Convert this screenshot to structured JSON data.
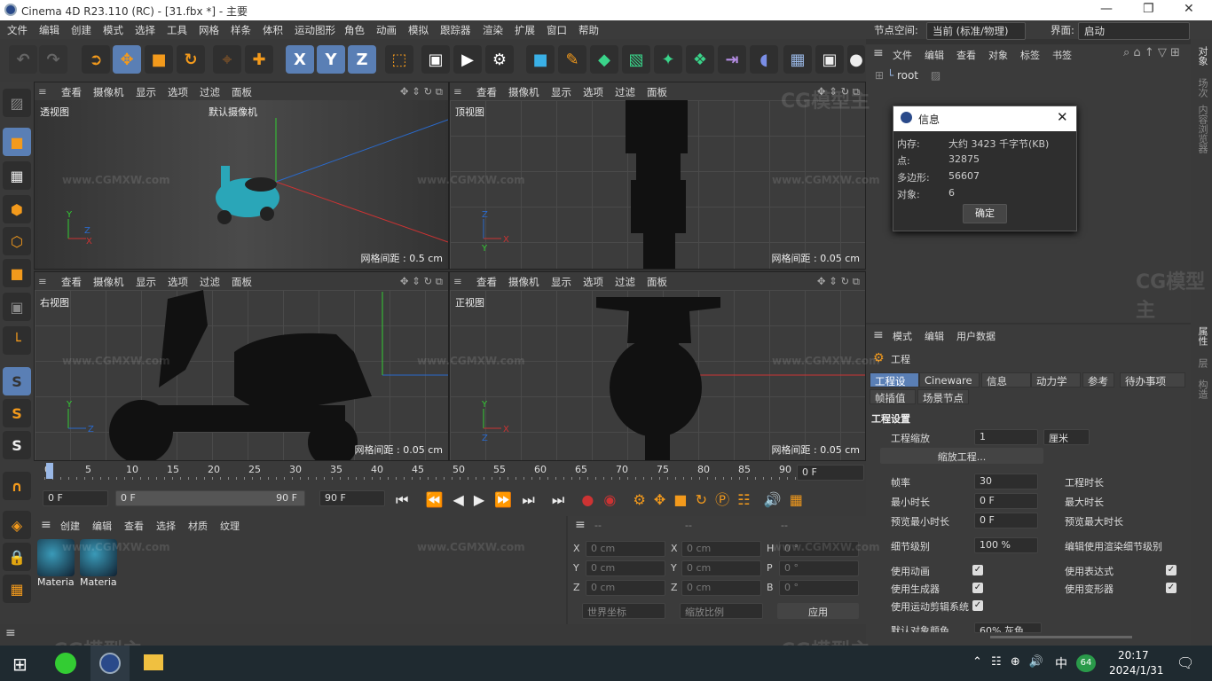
{
  "title": "Cinema 4D R23.110 (RC) - [31.fbx *] - 主要",
  "menu": [
    "文件",
    "编辑",
    "创建",
    "模式",
    "选择",
    "工具",
    "网格",
    "样条",
    "体积",
    "运动图形",
    "角色",
    "动画",
    "模拟",
    "跟踪器",
    "渲染",
    "扩展",
    "窗口",
    "帮助"
  ],
  "node_space_label": "节点空间:",
  "node_space_value": "当前 (标准/物理)",
  "interface_label": "界面:",
  "interface_value": "启动",
  "toolbar_icons": [
    "undo-icon",
    "redo-icon",
    "select-icon",
    "move-icon",
    "scale-icon",
    "rotate-icon",
    "live-select-icon",
    "move-axis-icon",
    "x-axis-icon",
    "y-axis-icon",
    "z-axis-icon",
    "world-coords-icon",
    "render-view-icon",
    "render-icon",
    "render-settings-icon",
    "cube-icon",
    "pen-icon",
    "subdivision-icon",
    "extrude-icon",
    "cloner-icon",
    "array-icon",
    "deformer-icon",
    "spline-icon",
    "floor-icon",
    "camera-icon",
    "light-icon"
  ],
  "axis_letters": [
    "X",
    "Y",
    "Z"
  ],
  "viewport_menu": [
    "查看",
    "摄像机",
    "显示",
    "选项",
    "过滤",
    "面板"
  ],
  "viewports": [
    {
      "label": "透视图",
      "camera": "默认摄像机",
      "grid": "网格间距 : 0.5 cm"
    },
    {
      "label": "顶视图",
      "camera": "",
      "grid": "网格间距 : 0.05 cm"
    },
    {
      "label": "右视图",
      "camera": "",
      "grid": "网格间距 : 0.05 cm"
    },
    {
      "label": "正视图",
      "camera": "",
      "grid": "网格间距 : 0.05 cm"
    }
  ],
  "timeline": {
    "ticks": [
      "0",
      "5",
      "10",
      "15",
      "20",
      "25",
      "30",
      "35",
      "40",
      "45",
      "50",
      "55",
      "60",
      "65",
      "70",
      "75",
      "80",
      "85",
      "90"
    ],
    "end_frame": "0 F",
    "start": "0 F",
    "range_start": "0 F",
    "range_end": "90 F",
    "max": "90 F"
  },
  "material_menu": [
    "创建",
    "编辑",
    "查看",
    "选择",
    "材质",
    "纹理"
  ],
  "materials": [
    "Materia",
    "Materia"
  ],
  "coords": {
    "headers": [
      "--",
      "--",
      "--"
    ],
    "rows": [
      {
        "a": "X",
        "av": "0 cm",
        "b": "X",
        "bv": "0 cm",
        "c": "H",
        "cv": "0 °"
      },
      {
        "a": "Y",
        "av": "0 cm",
        "b": "Y",
        "bv": "0 cm",
        "c": "P",
        "cv": "0 °"
      },
      {
        "a": "Z",
        "av": "0 cm",
        "b": "Z",
        "bv": "0 cm",
        "c": "B",
        "cv": "0 °"
      }
    ],
    "world": "世界坐标",
    "scale": "缩放比例",
    "apply": "应用"
  },
  "objects_menu": [
    "文件",
    "编辑",
    "查看",
    "对象",
    "标签",
    "书签"
  ],
  "root": "root",
  "info_dialog": {
    "title": "信息",
    "rows": [
      {
        "k": "内存:",
        "v": "大约 3423 千字节(KB)"
      },
      {
        "k": "点:",
        "v": "32875"
      },
      {
        "k": "多边形:",
        "v": "56607"
      },
      {
        "k": "对象:",
        "v": "6"
      }
    ],
    "ok": "确定"
  },
  "attr_menu": [
    "模式",
    "编辑",
    "用户数据"
  ],
  "project_label": "工程",
  "attr_tabs": [
    "工程设置",
    "Cineware",
    "信息",
    "动力学",
    "参考",
    "待办事项",
    "帧插值",
    "场景节点"
  ],
  "section_title": "工程设置",
  "scale_label": "工程缩放",
  "scale_value": "1",
  "scale_unit": "厘米",
  "scale_button": "缩放工程...",
  "fps_label": "帧率",
  "fps_value": "30",
  "duration_label": "工程时长",
  "min_time_label": "最小时长",
  "min_time_value": "0 F",
  "max_time_label": "最大时长",
  "preview_min_label": "预览最小时长",
  "preview_min_value": "0 F",
  "preview_max_label": "预览最大时长",
  "lod_label": "细节级别",
  "lod_value": "100 %",
  "render_lod_label": "编辑使用渲染细节级别",
  "use_anim": "使用动画",
  "use_expr": "使用表达式",
  "use_gen": "使用生成器",
  "use_deform": "使用变形器",
  "use_motion": "使用运动剪辑系统",
  "default_color_label": "默认对象颜色",
  "default_color_value": "60% 灰色",
  "right_tabs": [
    "对象",
    "场次",
    "内容浏览器",
    "属性",
    "层",
    "构造"
  ],
  "watermark": "www.CGMXW.com",
  "watermark_logo": "CG模型主",
  "taskbar": {
    "ime": "中",
    "badge": "64",
    "time": "20:17",
    "date": "2024/1/31"
  },
  "colors": {
    "accent": "#5a7fb5",
    "bg": "#333333",
    "toolbar": "#393939"
  }
}
